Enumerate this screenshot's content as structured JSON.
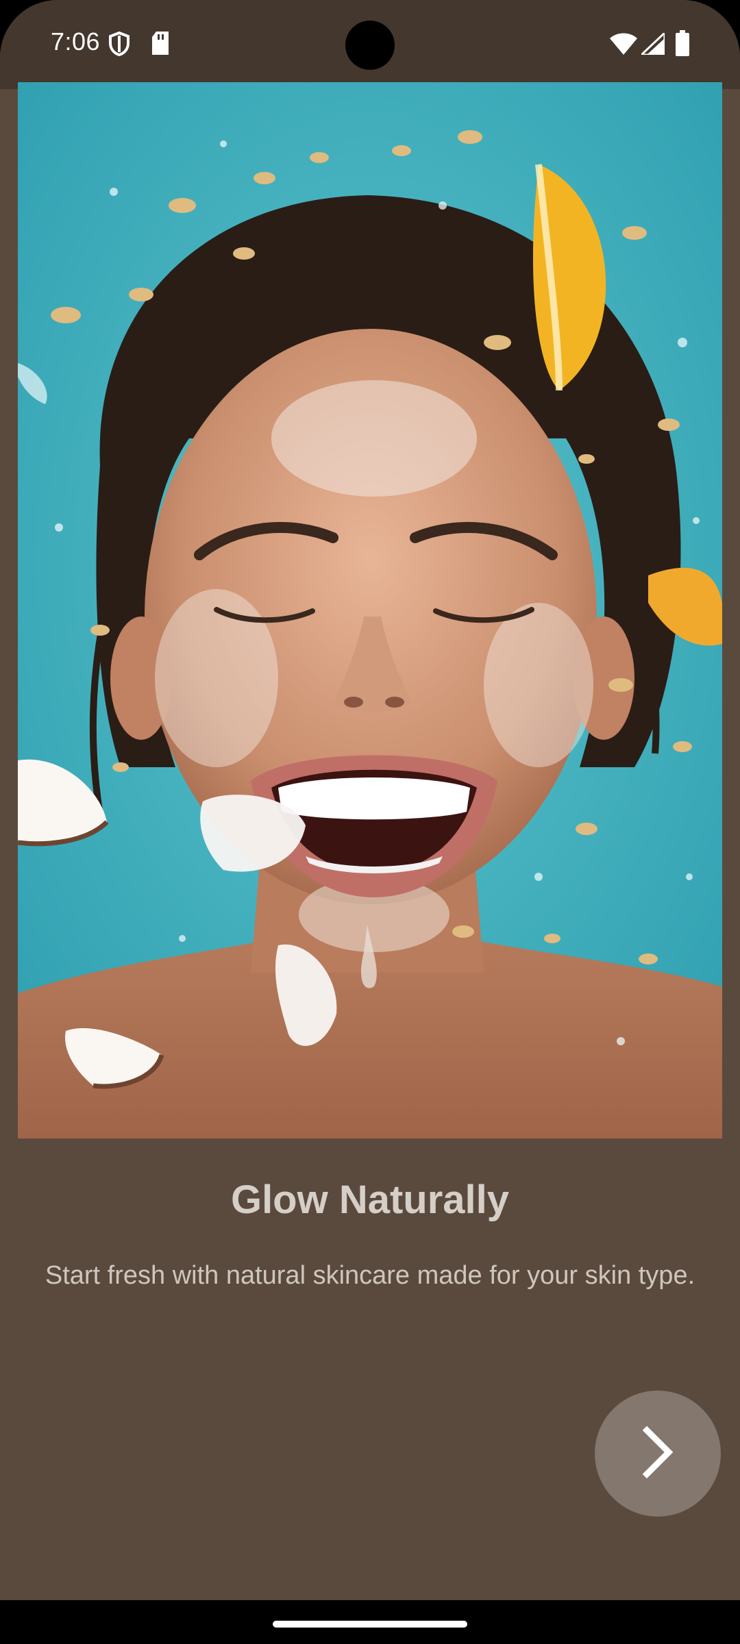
{
  "status_bar": {
    "time": "7:06",
    "left_icons": [
      "shield-icon",
      "sd-card-icon"
    ],
    "right_icons": [
      "wifi-icon",
      "signal-icon",
      "battery-icon"
    ]
  },
  "hero_image": {
    "subject": "smiling-woman-with-foam-photo"
  },
  "onboarding": {
    "title": "Glow Naturally",
    "description": "Start fresh with natural skincare made for your skin type."
  },
  "next_button": {
    "icon": "chevron-right-icon"
  },
  "colors": {
    "background": "#5a4a3e",
    "status_bar": "#43372e",
    "title": "#d6cfc8",
    "description": "#cfc6bd",
    "button": "#83776e",
    "hero_backdrop": "#3fb1bf"
  }
}
